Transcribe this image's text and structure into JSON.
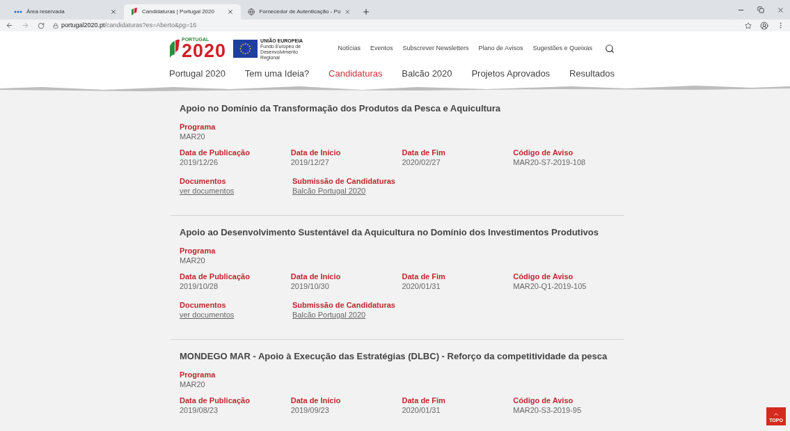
{
  "browser": {
    "tabs": [
      {
        "title": "Área reservada",
        "selected": false,
        "kind": "dots"
      },
      {
        "title": "Candidaturas | Portugal 2020",
        "selected": true,
        "kind": "flag"
      },
      {
        "title": "Fornecedor de Autenticação - Po",
        "selected": false,
        "kind": "globe"
      }
    ],
    "url_host": "portugal2020.pt",
    "url_path": "/candidaturas?es=Aberto&pg=16"
  },
  "header": {
    "logo": {
      "small": "PORTUGAL",
      "big": "2020"
    },
    "eu": {
      "title": "UNIÃO EUROPEIA",
      "subtitle": "Fundo Europeu de Desenvolvimento Regional"
    },
    "top_links": [
      "Notícias",
      "Eventos",
      "Subscrever Newsletters",
      "Plano de Avisos",
      "Sugestões e Queixas"
    ],
    "main_nav": [
      {
        "label": "Portugal 2020",
        "selected": false
      },
      {
        "label": "Tem uma Ideia?",
        "selected": false
      },
      {
        "label": "Candidaturas",
        "selected": true
      },
      {
        "label": "Balcão 2020",
        "selected": false
      },
      {
        "label": "Projetos Aprovados",
        "selected": false
      },
      {
        "label": "Resultados",
        "selected": false
      }
    ]
  },
  "notices": [
    {
      "title": "Apoio no Domínio da Transformação dos Produtos da Pesca e Aquicultura",
      "rows": [
        [
          {
            "label": "Programa",
            "value": "MAR20",
            "kind": "text"
          }
        ],
        [
          {
            "label": "Data de Publicação",
            "value": "2019/12/26",
            "kind": "text"
          },
          {
            "label": "Data de Início",
            "value": "2019/12/27",
            "kind": "text"
          },
          {
            "label": "Data de Fim",
            "value": "2020/02/27",
            "kind": "text"
          },
          {
            "label": "Código de Aviso",
            "value": "MAR20-S7-2019-108",
            "kind": "text"
          }
        ],
        [
          {
            "label": "Documentos",
            "value": "ver documentos",
            "kind": "link"
          },
          {
            "label": "Submissão de Candidaturas",
            "value": "Balcão Portugal 2020",
            "kind": "link"
          }
        ]
      ]
    },
    {
      "title": "Apoio ao Desenvolvimento Sustentável da Aquicultura no Domínio dos Investimentos Produtivos",
      "rows": [
        [
          {
            "label": "Programa",
            "value": "MAR20",
            "kind": "text"
          }
        ],
        [
          {
            "label": "Data de Publicação",
            "value": "2019/10/28",
            "kind": "text"
          },
          {
            "label": "Data de Início",
            "value": "2019/10/30",
            "kind": "text"
          },
          {
            "label": "Data de Fim",
            "value": "2020/01/31",
            "kind": "text"
          },
          {
            "label": "Código de Aviso",
            "value": "MAR20-Q1-2019-105",
            "kind": "text"
          }
        ],
        [
          {
            "label": "Documentos",
            "value": "ver documentos",
            "kind": "link"
          },
          {
            "label": "Submissão de Candidaturas",
            "value": "Balcão Portugal 2020",
            "kind": "link"
          }
        ]
      ]
    },
    {
      "title": "MONDEGO MAR - Apoio à Execução das Estratégias (DLBC) - Reforço da competitividade da pesca",
      "rows": [
        [
          {
            "label": "Programa",
            "value": "MAR20",
            "kind": "text"
          }
        ],
        [
          {
            "label": "Data de Publicação",
            "value": "2019/08/23",
            "kind": "text"
          },
          {
            "label": "Data de Início",
            "value": "2019/09/23",
            "kind": "text"
          },
          {
            "label": "Data de Fim",
            "value": "2020/01/31",
            "kind": "text"
          },
          {
            "label": "Código de Aviso",
            "value": "MAR20-S3-2019-95",
            "kind": "text"
          }
        ]
      ]
    }
  ],
  "back_to_top": "TOPO"
}
